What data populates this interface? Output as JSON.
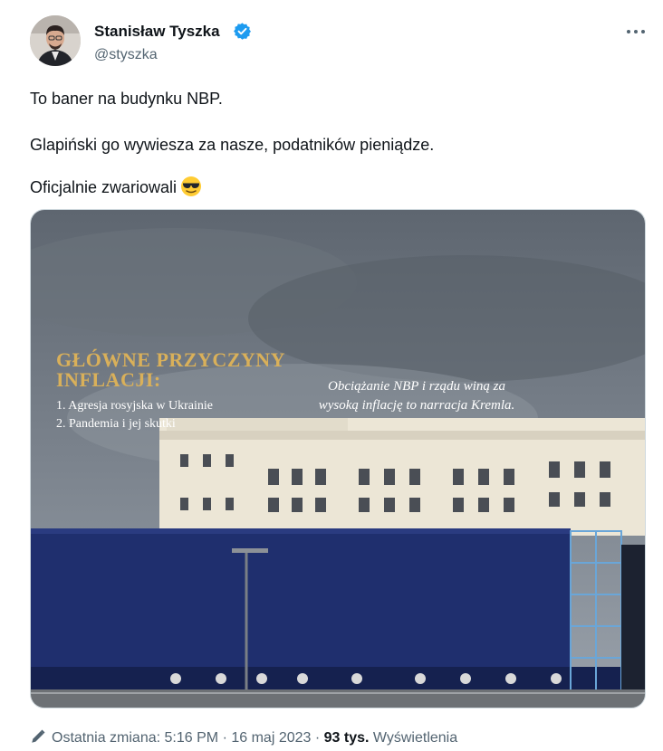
{
  "author": {
    "name": "Stanisław Tyszka",
    "handle": "@styszka"
  },
  "tweet": {
    "line1": "To baner na budynku NBP.",
    "line2": "Glapiński go wywiesza za nasze, podatników pieniądze.",
    "line3": "Oficjalnie zwariowali"
  },
  "banner": {
    "title1": "GŁÓWNE PRZYCZYNY",
    "title2": "INFLACJI:",
    "item1": "1. Agresja rosyjska w Ukrainie",
    "item2": "2. Pandemia i jej skutki",
    "quote1": "Obciążanie NBP i rządu winą za",
    "quote2": "wysoką inflację to narracja Kremla."
  },
  "footer": {
    "edited": "Ostatnia zmiana:",
    "time": "5:16 PM",
    "sep1": "·",
    "date": "16 maj 2023",
    "sep2": "·",
    "views_count": "93 tys.",
    "views_label": "Wyświetlenia"
  },
  "colors": {
    "verified": "#1d9bf0",
    "banner": "#1f2f6e",
    "gold": "#d9b05a"
  }
}
